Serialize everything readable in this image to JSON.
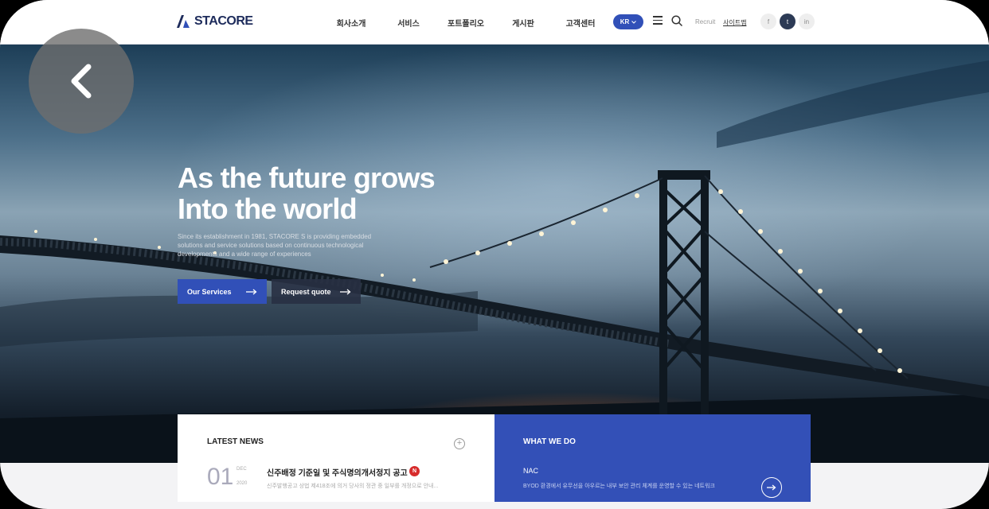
{
  "header": {
    "logo_text": "STACORE",
    "nav": [
      "회사소개",
      "서비스",
      "포트폴리오",
      "게시판",
      "고객센터"
    ],
    "lang": "KR",
    "recruit": "Recruit",
    "sitemap": "사이트맵",
    "social": [
      "f",
      "t",
      "in"
    ]
  },
  "hero": {
    "title_line1": "As the future grows",
    "title_line2": "Into the world",
    "description": "Since its establishment in 1981, STACORE S is providing embedded solutions and service solutions based on continuous technological developments and a wide range of experiences",
    "primary_button": "Our Services",
    "secondary_button": "Request quote"
  },
  "news": {
    "title": "LATEST NEWS",
    "day": "01",
    "month": "DEC",
    "year": "2020",
    "headline": "신주배정 기준일 및 주식명의개서정지 공고",
    "badge": "N",
    "summary": "신주발행공고 상법 제418조에 의거 당사의 정관 중 일부를 개정으로 안내..."
  },
  "what_we_do": {
    "title": "WHAT WE DO",
    "item": "NAC",
    "description": "BYOD 환경에서 유무선을 아우르는 내부 보안 관리 체계를 운영할 수 있는 네트워크"
  },
  "icons": {
    "back": "chevron-left-icon",
    "menu": "hamburger-icon",
    "search": "search-icon",
    "plus": "plus-icon",
    "arrow": "arrow-right-icon"
  },
  "colors": {
    "brand": "#3150b8",
    "header_bg": "#ffffff",
    "badge": "#d72c2c"
  }
}
